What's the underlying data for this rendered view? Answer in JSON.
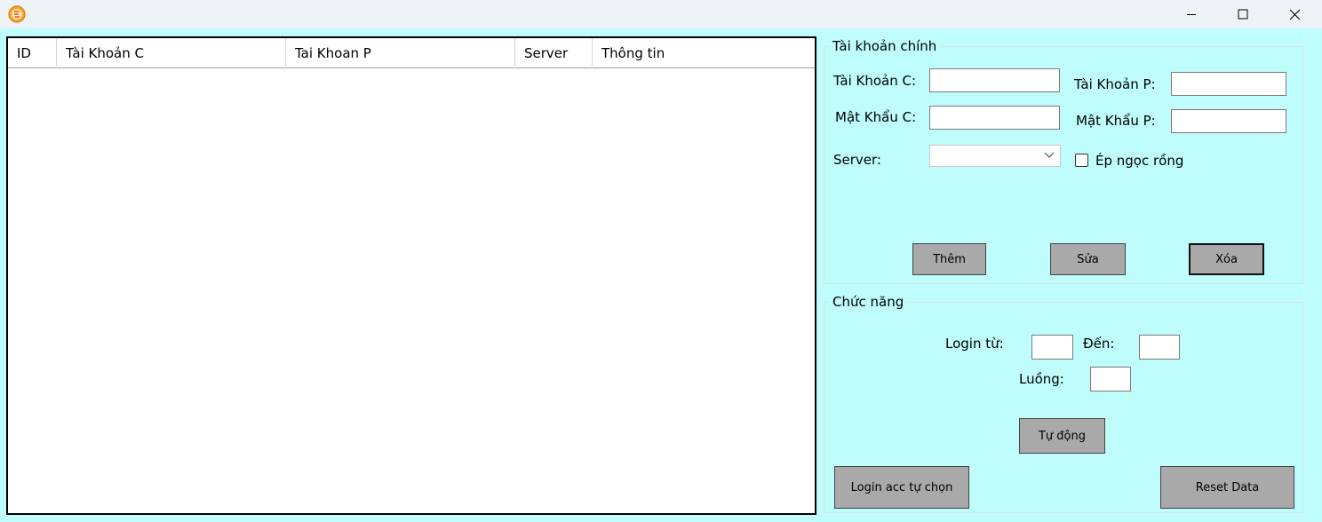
{
  "window": {
    "icon": "app-logo-icon",
    "controls": [
      "minimize-icon",
      "maximize-icon",
      "close-icon"
    ]
  },
  "list": {
    "columns": [
      "ID",
      "Tài Khoản C",
      "Tai Khoan P",
      "Server",
      "Thông tin"
    ],
    "rows": []
  },
  "main_account": {
    "title": "Tài khoản chính",
    "account_c_label": "Tài Khoản C:",
    "account_c_value": "",
    "account_p_label": "Tài Khoản P:",
    "account_p_value": "",
    "password_c_label": "Mật Khẩu C:",
    "password_c_value": "",
    "password_p_label": "Mật Khẩu P:",
    "password_p_value": "",
    "server_label": "Server:",
    "server_value": "",
    "ep_checkbox_label": "Ép ngọc rồng",
    "ep_checked": false,
    "add_label": "Thêm",
    "edit_label": "Sửa",
    "delete_label": "Xóa"
  },
  "functions": {
    "title": "Chức năng",
    "login_from_label": "Login từ:",
    "login_from_value": "",
    "to_label": "Đến:",
    "to_value": "",
    "threads_label": "Luồng:",
    "threads_value": "",
    "auto_label": "Tự động",
    "login_selected_label": "Login acc tự chọn",
    "reset_label": "Reset Data"
  }
}
